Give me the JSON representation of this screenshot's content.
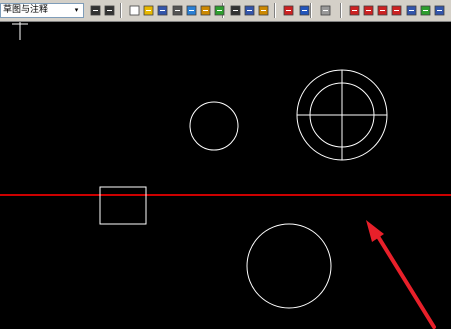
{
  "toolbar": {
    "workspace_label": "草图与注释",
    "dropdown_arrow": "▾",
    "buttons": [
      {
        "name": "match-properties-icon",
        "color": "#333333"
      },
      {
        "name": "layer-manager-icon",
        "color": "#333333"
      },
      {
        "name": "new-file-icon",
        "color": "#ffffff"
      },
      {
        "name": "open-file-icon",
        "color": "#e8b800"
      },
      {
        "name": "save-icon",
        "color": "#3355aa"
      },
      {
        "name": "print-icon",
        "color": "#555555"
      },
      {
        "name": "print-preview-icon",
        "color": "#2a7fd4"
      },
      {
        "name": "plot-icon",
        "color": "#cc8800"
      },
      {
        "name": "publish-icon",
        "color": "#2e9e2e"
      },
      {
        "name": "cut-icon",
        "color": "#333333"
      },
      {
        "name": "copy-icon",
        "color": "#3355aa"
      },
      {
        "name": "paste-icon",
        "color": "#cc8800"
      },
      {
        "name": "match-brush-icon",
        "color": "#cc2222"
      },
      {
        "name": "undo-icon",
        "color": "#2255bb"
      },
      {
        "name": "redo-icon",
        "color": "#999999"
      },
      {
        "name": "pan-icon",
        "color": "#cc2222"
      },
      {
        "name": "zoom-realtime-icon",
        "color": "#cc2222"
      },
      {
        "name": "zoom-window-icon",
        "color": "#cc2222"
      },
      {
        "name": "zoom-previous-icon",
        "color": "#cc2222"
      },
      {
        "name": "properties-icon",
        "color": "#3355aa"
      },
      {
        "name": "design-center-icon",
        "color": "#2e9e2e"
      },
      {
        "name": "tool-palettes-icon",
        "color": "#3355aa"
      },
      {
        "name": "sheet-set-icon",
        "color": "#2a7fd4"
      }
    ]
  },
  "colors": {
    "canvas_bg": "#000000",
    "geometry_stroke": "#ffffff",
    "construction_line": "#cc0000",
    "annotation_arrow": "#e8202a"
  }
}
